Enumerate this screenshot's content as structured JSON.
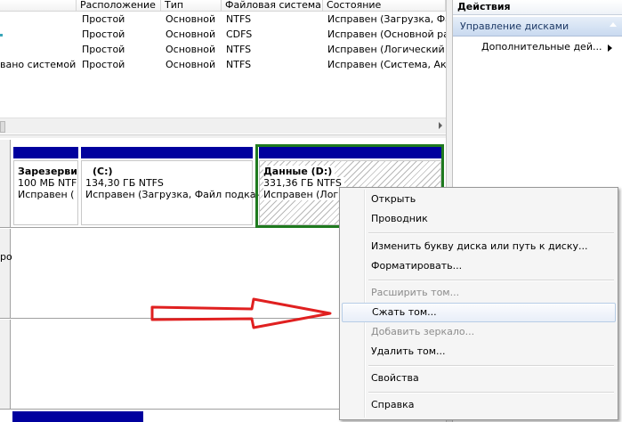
{
  "volume_list": {
    "columns": [
      "",
      "Расположение",
      "Тип",
      "Файловая система",
      "Состояние"
    ],
    "rows": [
      {
        "name": "",
        "layout": "Простой",
        "type": "Основной",
        "fs": "NTFS",
        "status": "Исправен (Загрузка, Файл"
      },
      {
        "name": "",
        "layout": "Простой",
        "type": "Основной",
        "fs": "CDFS",
        "status": "Исправен (Основной раз"
      },
      {
        "name": "",
        "layout": "Простой",
        "type": "Основной",
        "fs": "NTFS",
        "status": "Исправен (Логический ди"
      },
      {
        "name": "вано системой",
        "layout": "Простой",
        "type": "Основной",
        "fs": "NTFS",
        "status": "Исправен (Система, Акти"
      }
    ]
  },
  "disk_map": {
    "partitions": [
      {
        "name": "Зарезерви",
        "size": "100 МБ NTF",
        "status": "Исправен ("
      },
      {
        "name": "(C:)",
        "size": "134,30 ГБ NTFS",
        "status": "Исправен (Загрузка, Файл подкач"
      },
      {
        "name": "Данные  (D:)",
        "size": "331,36 ГБ NTFS",
        "status": "Исправен (Логи"
      }
    ],
    "side_fragment": "ро"
  },
  "actions": {
    "title": "Действия",
    "section": "Управление дисками",
    "more": "Дополнительные дей..."
  },
  "context_menu": {
    "items": [
      {
        "label": "Открыть",
        "enabled": true
      },
      {
        "label": "Проводник",
        "enabled": true
      },
      {
        "label": "Изменить букву диска или путь к диску...",
        "enabled": true
      },
      {
        "label": "Форматировать...",
        "enabled": true
      },
      {
        "label": "Расширить том...",
        "enabled": false
      },
      {
        "label": "Сжать том...",
        "enabled": true,
        "highlighted": true
      },
      {
        "label": "Добавить зеркало...",
        "enabled": false
      },
      {
        "label": "Удалить том...",
        "enabled": true
      },
      {
        "label": "Свойства",
        "enabled": true
      },
      {
        "label": "Справка",
        "enabled": true
      }
    ]
  },
  "colors": {
    "partition_bar": "#00009e",
    "selected_border": "#1f7a1f",
    "annotation_arrow": "#e02020",
    "menu_highlight": "#e8eef8"
  },
  "annotation": {
    "arrow_target": "Сжать том..."
  }
}
